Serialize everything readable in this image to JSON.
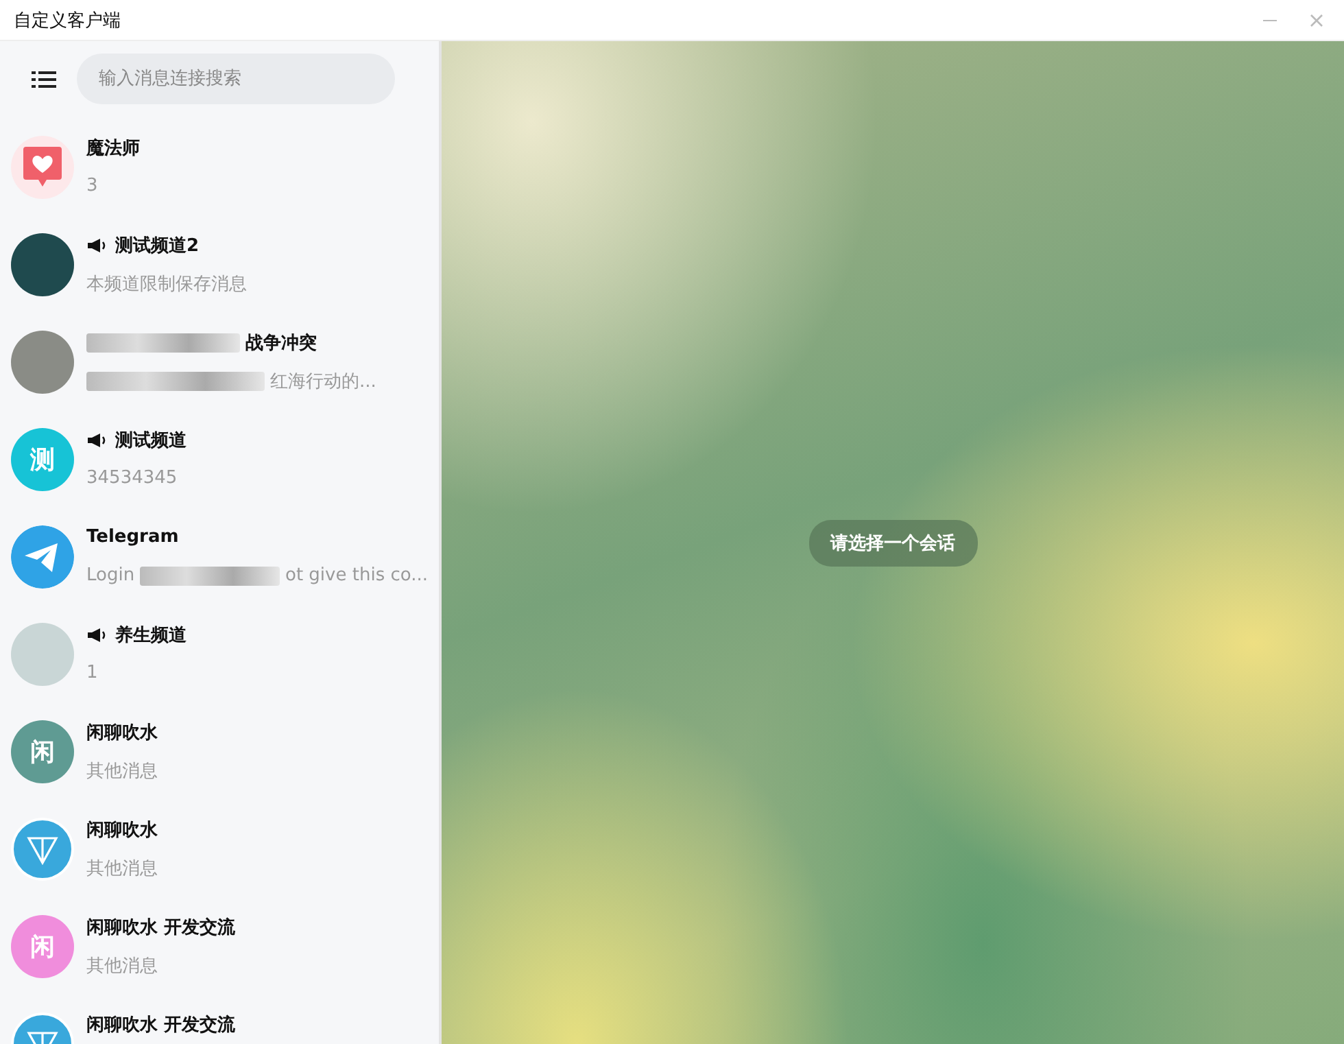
{
  "window": {
    "title": "自定义客户端"
  },
  "search": {
    "placeholder": "输入消息连接搜索"
  },
  "chats": [
    {
      "avatar": {
        "kind": "heart"
      },
      "channel": false,
      "title": [
        {
          "kind": "text",
          "text": "魔法师"
        }
      ],
      "preview": [
        {
          "kind": "text",
          "text": "3"
        }
      ]
    },
    {
      "avatar": {
        "kind": "photo",
        "color": "#1f4a4e"
      },
      "channel": true,
      "title": [
        {
          "kind": "text",
          "text": "测试频道2"
        }
      ],
      "preview": [
        {
          "kind": "text",
          "text": "本频道限制保存消息"
        }
      ]
    },
    {
      "avatar": {
        "kind": "photo",
        "color": "#8a8c86"
      },
      "channel": false,
      "title": [
        {
          "kind": "redacted"
        },
        {
          "kind": "text",
          "text": "战争冲突"
        }
      ],
      "preview": [
        {
          "kind": "redacted"
        },
        {
          "kind": "text",
          "text": "红海行动的..."
        }
      ]
    },
    {
      "avatar": {
        "kind": "letter",
        "text": "测",
        "color": "#17c3d6"
      },
      "channel": true,
      "title": [
        {
          "kind": "text",
          "text": "测试频道"
        }
      ],
      "preview": [
        {
          "kind": "text",
          "text": "34534345"
        }
      ]
    },
    {
      "avatar": {
        "kind": "telegram",
        "color": "#2fa3e6"
      },
      "channel": false,
      "title": [
        {
          "kind": "text",
          "text": "Telegram"
        }
      ],
      "preview": [
        {
          "kind": "text",
          "text": "Login"
        },
        {
          "kind": "redacted"
        },
        {
          "kind": "text",
          "text": "ot give this co..."
        }
      ]
    },
    {
      "avatar": {
        "kind": "photo",
        "color": "#c9d6d6"
      },
      "channel": true,
      "title": [
        {
          "kind": "text",
          "text": "养生频道"
        }
      ],
      "preview": [
        {
          "kind": "text",
          "text": "1"
        }
      ]
    },
    {
      "avatar": {
        "kind": "letter",
        "text": "闲",
        "color": "#5f9b93"
      },
      "channel": false,
      "title": [
        {
          "kind": "text",
          "text": "闲聊吹水"
        }
      ],
      "preview": [
        {
          "kind": "text",
          "text": "其他消息"
        }
      ]
    },
    {
      "avatar": {
        "kind": "ton",
        "color": "#39a8dc"
      },
      "channel": false,
      "title": [
        {
          "kind": "text",
          "text": "闲聊吹水"
        }
      ],
      "preview": [
        {
          "kind": "text",
          "text": "其他消息"
        }
      ]
    },
    {
      "avatar": {
        "kind": "letter",
        "text": "闲",
        "color": "#f08ddc"
      },
      "channel": false,
      "title": [
        {
          "kind": "text",
          "text": "闲聊吹水 开发交流"
        }
      ],
      "preview": [
        {
          "kind": "text",
          "text": "其他消息"
        }
      ]
    },
    {
      "avatar": {
        "kind": "ton",
        "color": "#39a8dc"
      },
      "channel": false,
      "title": [
        {
          "kind": "text",
          "text": "闲聊吹水 开发交流"
        }
      ]
    }
  ],
  "empty_state": {
    "text": "请选择一个会话"
  }
}
